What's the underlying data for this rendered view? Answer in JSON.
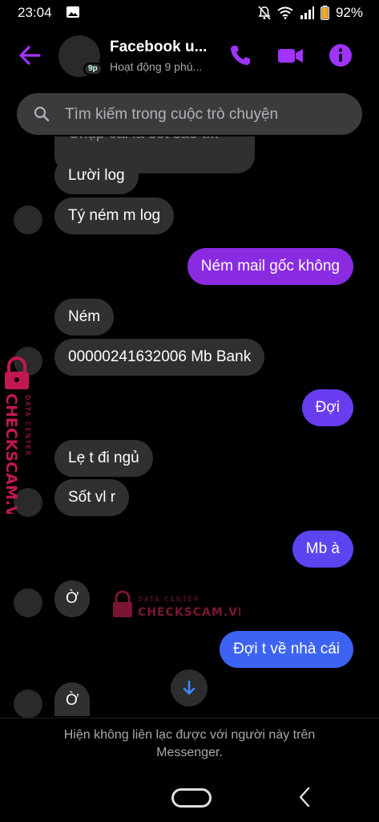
{
  "status_bar": {
    "time": "23:04",
    "battery": "92%"
  },
  "header": {
    "name": "Facebook u...",
    "active": "Hoạt động 9 phú...",
    "badge": "9p"
  },
  "search": {
    "placeholder": "Tìm kiếm trong cuộc trò chuyện"
  },
  "messages": [
    {
      "text": "Lười log",
      "side": "in"
    },
    {
      "text": "Tý ném m log",
      "side": "in"
    },
    {
      "text": "Ném mail gốc không",
      "side": "out"
    },
    {
      "text": "Ném",
      "side": "in"
    },
    {
      "text": "00000241632006 Mb Bank",
      "side": "in"
    },
    {
      "text": "Đợi",
      "side": "out"
    },
    {
      "text": "Lẹ t đi ngủ",
      "side": "in"
    },
    {
      "text": "Sốt vl r",
      "side": "in"
    },
    {
      "text": "Mb à",
      "side": "out"
    },
    {
      "text": "Ờ",
      "side": "in"
    },
    {
      "text": "Đợi t về nhà cái",
      "side": "out"
    },
    {
      "text": "Ờ",
      "side": "in"
    }
  ],
  "partial_message": "Chụp cái là sốt sao t...",
  "footer": {
    "notice": "Hiện không liên lạc được với người này trên Messenger."
  },
  "watermark": {
    "line1": "DATA CENTER",
    "line2": "CHECKSCAM.VN"
  },
  "colors": {
    "accent": "#a033ff",
    "incoming": "#303030",
    "outgoing_purple": "#8a2be2",
    "outgoing_violet": "#6a3cf0",
    "outgoing_blue": "#3d63f2"
  }
}
